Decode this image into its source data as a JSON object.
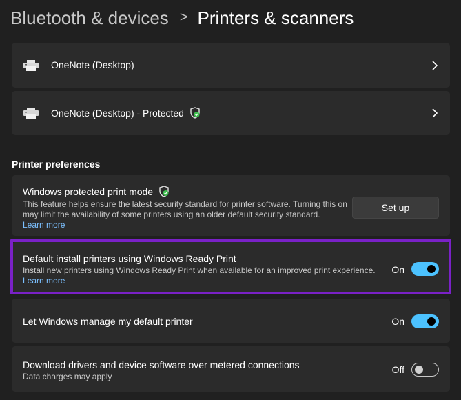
{
  "breadcrumb": {
    "parent": "Bluetooth & devices",
    "separator": ">",
    "current": "Printers & scanners"
  },
  "printers": [
    {
      "name": "OneNote (Desktop)",
      "icon": "printer-icon",
      "protected": false
    },
    {
      "name": "OneNote (Desktop) - Protected",
      "icon": "printer-icon",
      "protected": true
    }
  ],
  "preferences": {
    "heading": "Printer preferences",
    "protected_mode": {
      "title": "Windows protected print mode",
      "description": "This feature helps ensure the latest security standard for printer software. Turning this on may limit the availability of some printers using an older default security standard.",
      "link": "Learn more",
      "button": "Set up"
    },
    "ready_print": {
      "title": "Default install printers using Windows Ready Print",
      "description": "Install new printers using Windows Ready Print when available for an improved print experience.",
      "link": "Learn more",
      "state_label": "On",
      "state": true
    },
    "manage_default": {
      "title": "Let Windows manage my default printer",
      "state_label": "On",
      "state": true
    },
    "metered": {
      "title": "Download drivers and device software over metered connections",
      "description": "Data charges may apply",
      "state_label": "Off",
      "state": false
    }
  },
  "colors": {
    "background": "#202020",
    "card": "#2b2b2b",
    "accent": "#4cc2ff",
    "link": "#7cc0ff",
    "highlight_border": "#7a21c7",
    "shield_check": "#3fbf4f"
  }
}
